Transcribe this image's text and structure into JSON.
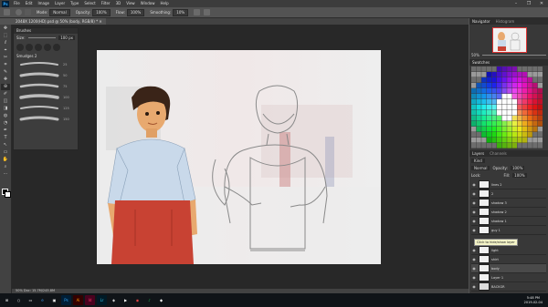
{
  "app": {
    "logo": "Ps",
    "menu": [
      "File",
      "Edit",
      "Image",
      "Layer",
      "Type",
      "Select",
      "Filter",
      "3D",
      "View",
      "Window",
      "Help"
    ],
    "window_controls": [
      "–",
      "❐",
      "✕"
    ]
  },
  "options": {
    "mode_label": "Mode:",
    "mode_value": "Normal",
    "opacity_label": "Opacity:",
    "opacity_value": "100%",
    "flow_label": "Flow:",
    "flow_value": "100%",
    "smoothing_label": "Smoothing:",
    "smoothing_value": "10%"
  },
  "document_tab": {
    "label": "2048X 1200(HD).psd @ 50% (body, RGB/8) *  ✕"
  },
  "tools": [
    "✥",
    "⬚",
    "ℓ",
    "⌖",
    "✂",
    "⌗",
    "✎",
    "✚",
    "⊕",
    "✐",
    "◫",
    "◨",
    "◍",
    "◔",
    "✒",
    "T",
    "↖",
    "▭",
    "✋",
    "⌕",
    "⋯"
  ],
  "brush_panel": {
    "title": "Brushes",
    "size_label": "Size:",
    "size_value": "100 px",
    "group_label": "Smudges 2",
    "stroke_labels": [
      "25",
      "50",
      "75",
      "100",
      "125",
      "150"
    ]
  },
  "navigator": {
    "tabs": [
      "Navigator",
      "Histogram"
    ],
    "zoom": "50%"
  },
  "swatches_tab": "Swatches",
  "layers": {
    "tabs": [
      "Layers",
      "Channels"
    ],
    "kind_label": "Kind",
    "blend": "Normal",
    "opacity_label": "Opacity:",
    "opacity_value": "100%",
    "lock_label": "Lock:",
    "fill_label": "Fill:",
    "fill_value": "100%",
    "rows": [
      {
        "name": "lines 2"
      },
      {
        "name": "2"
      },
      {
        "name": "shadow 3"
      },
      {
        "name": "shadow 2"
      },
      {
        "name": "shadow 1"
      },
      {
        "name": "guy 1"
      },
      {
        "name": "light"
      },
      {
        "name": "shirt"
      },
      {
        "name": "body"
      },
      {
        "name": "Layer 1"
      },
      {
        "name": "BACKGR"
      }
    ],
    "tooltip": "Click to hide/show layer"
  },
  "status": {
    "text": "50%      Doc: 15.7M/245.8M"
  },
  "taskbar": {
    "start": "⊞",
    "apps": [
      "○",
      "▭",
      "e",
      "▣",
      "Ps",
      "Ai",
      "Id",
      "Lr",
      "◈",
      "▶",
      "◉",
      "♪",
      "◆"
    ],
    "time": "5:48 PM",
    "date": "2019-02-04"
  },
  "colors": {
    "accent": "#31a8ff",
    "canvas_bg": "#f4f4f4",
    "shirt": "#c9d9ea",
    "shorts": "#c84233",
    "skin": "#e8a96f",
    "hair": "#3a2418"
  }
}
